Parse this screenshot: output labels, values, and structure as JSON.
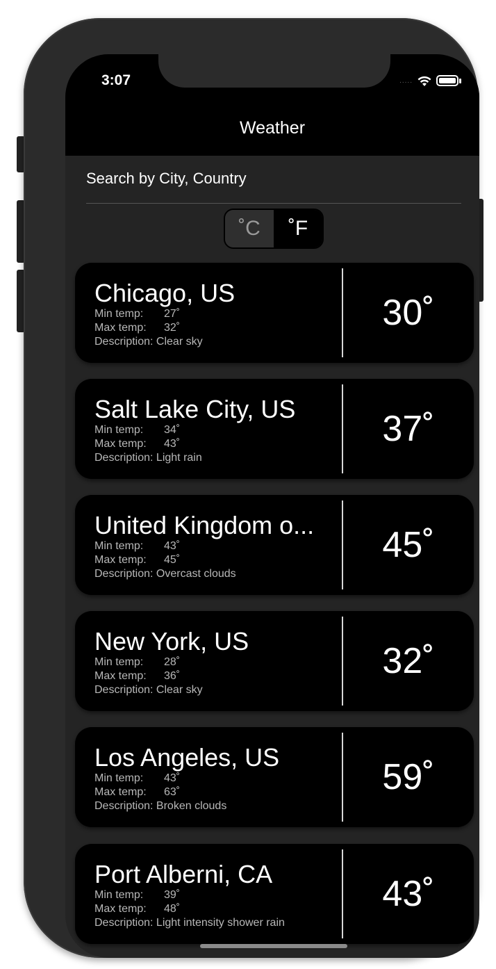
{
  "status_bar": {
    "time": "3:07",
    "signal_dots": "....."
  },
  "nav": {
    "title": "Weather"
  },
  "search": {
    "placeholder": "Search by City, Country"
  },
  "unit_toggle": {
    "celsius_label": "˚C",
    "fahrenheit_label": "˚F",
    "selected": "˚F"
  },
  "cards": [
    {
      "city": "Chicago, US",
      "min_label": "Min temp:",
      "min_value": "27˚",
      "max_label": "Max temp:",
      "max_value": "32˚",
      "description": "Description: Clear sky",
      "temp": "30˚"
    },
    {
      "city": "Salt Lake City, US",
      "min_label": "Min temp:",
      "min_value": "34˚",
      "max_label": "Max temp:",
      "max_value": "43˚",
      "description": "Description: Light rain",
      "temp": "37˚"
    },
    {
      "city": "United Kingdom o...",
      "min_label": "Min temp:",
      "min_value": "43˚",
      "max_label": "Max temp:",
      "max_value": "45˚",
      "description": "Description: Overcast clouds",
      "temp": "45˚"
    },
    {
      "city": "New York, US",
      "min_label": "Min temp:",
      "min_value": "28˚",
      "max_label": "Max temp:",
      "max_value": "36˚",
      "description": "Description: Clear sky",
      "temp": "32˚"
    },
    {
      "city": "Los Angeles, US",
      "min_label": "Min temp:",
      "min_value": "43˚",
      "max_label": "Max temp:",
      "max_value": "63˚",
      "description": "Description: Broken clouds",
      "temp": "59˚"
    },
    {
      "city": "Port Alberni, CA",
      "min_label": "Min temp:",
      "min_value": "39˚",
      "max_label": "Max temp:",
      "max_value": "48˚",
      "description": "Description: Light intensity shower rain",
      "temp": "43˚"
    }
  ]
}
